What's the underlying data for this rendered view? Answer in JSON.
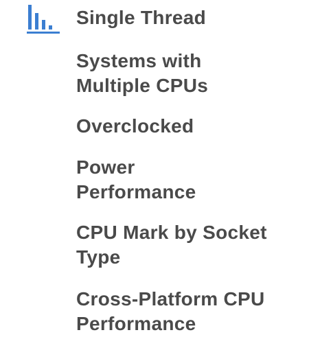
{
  "menu": {
    "icon": "bar-chart-icon",
    "accent_color": "#3b7ed1",
    "text_color": "#4a4a4a",
    "items": [
      {
        "label": "Single Thread"
      },
      {
        "label": "Systems with Multiple CPUs"
      },
      {
        "label": "Overclocked"
      },
      {
        "label": "Power Performance"
      },
      {
        "label": "CPU Mark by Socket Type"
      },
      {
        "label": "Cross-Platform CPU Performance"
      }
    ]
  }
}
